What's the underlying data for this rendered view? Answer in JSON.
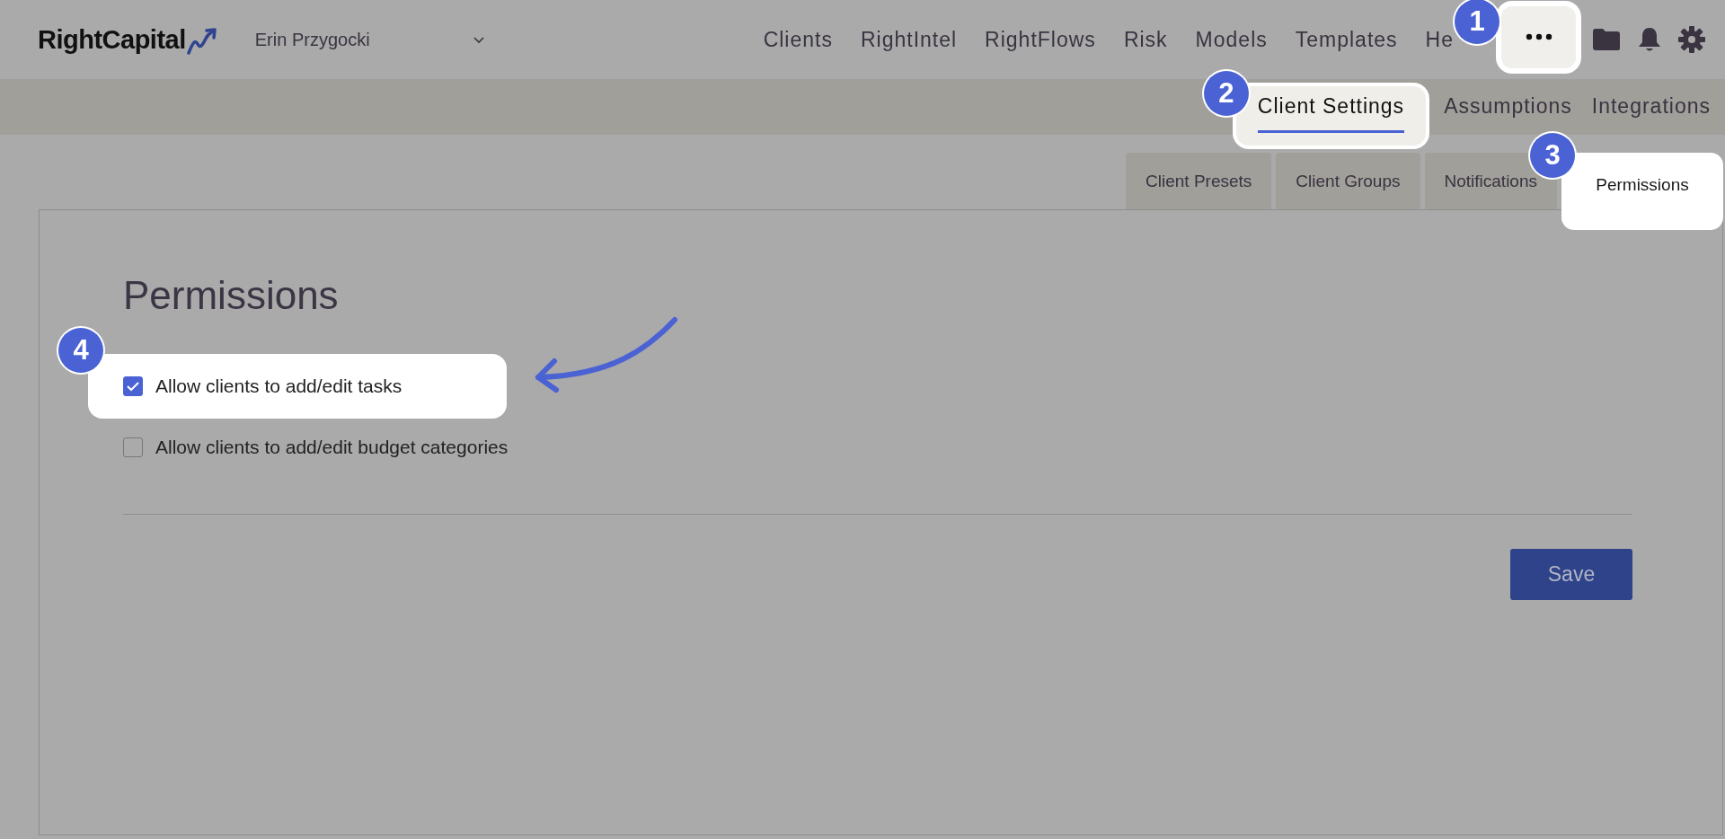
{
  "header": {
    "logo": "RightCapital",
    "user": "Erin Przygocki",
    "nav": [
      {
        "label": "Clients"
      },
      {
        "label": "RightIntel"
      },
      {
        "label": "RightFlows"
      },
      {
        "label": "Risk"
      },
      {
        "label": "Models"
      },
      {
        "label": "Templates"
      },
      {
        "label": "He"
      }
    ],
    "more": {
      "highlighted": true,
      "callout": "1"
    }
  },
  "subnav": [
    {
      "label": "Client Settings",
      "selected": true,
      "highlighted": true,
      "callout": "2"
    },
    {
      "label": "Assumptions",
      "selected": false,
      "highlighted": false
    },
    {
      "label": "Integrations",
      "selected": false,
      "highlighted": false
    }
  ],
  "tabs": [
    {
      "label": "Client Presets",
      "selected": false,
      "highlighted": false
    },
    {
      "label": "Client Groups",
      "selected": false,
      "highlighted": false
    },
    {
      "label": "Notifications",
      "selected": false,
      "highlighted": false
    },
    {
      "label": "Permissions",
      "selected": true,
      "highlighted": true,
      "callout": "3"
    }
  ],
  "panel": {
    "title": "Permissions",
    "options": [
      {
        "label": "Allow clients to add/edit tasks",
        "checked": true,
        "highlighted": true,
        "callout": "4"
      },
      {
        "label": "Allow clients to add/edit budget categories",
        "checked": false,
        "highlighted": false
      }
    ],
    "save": "Save"
  }
}
